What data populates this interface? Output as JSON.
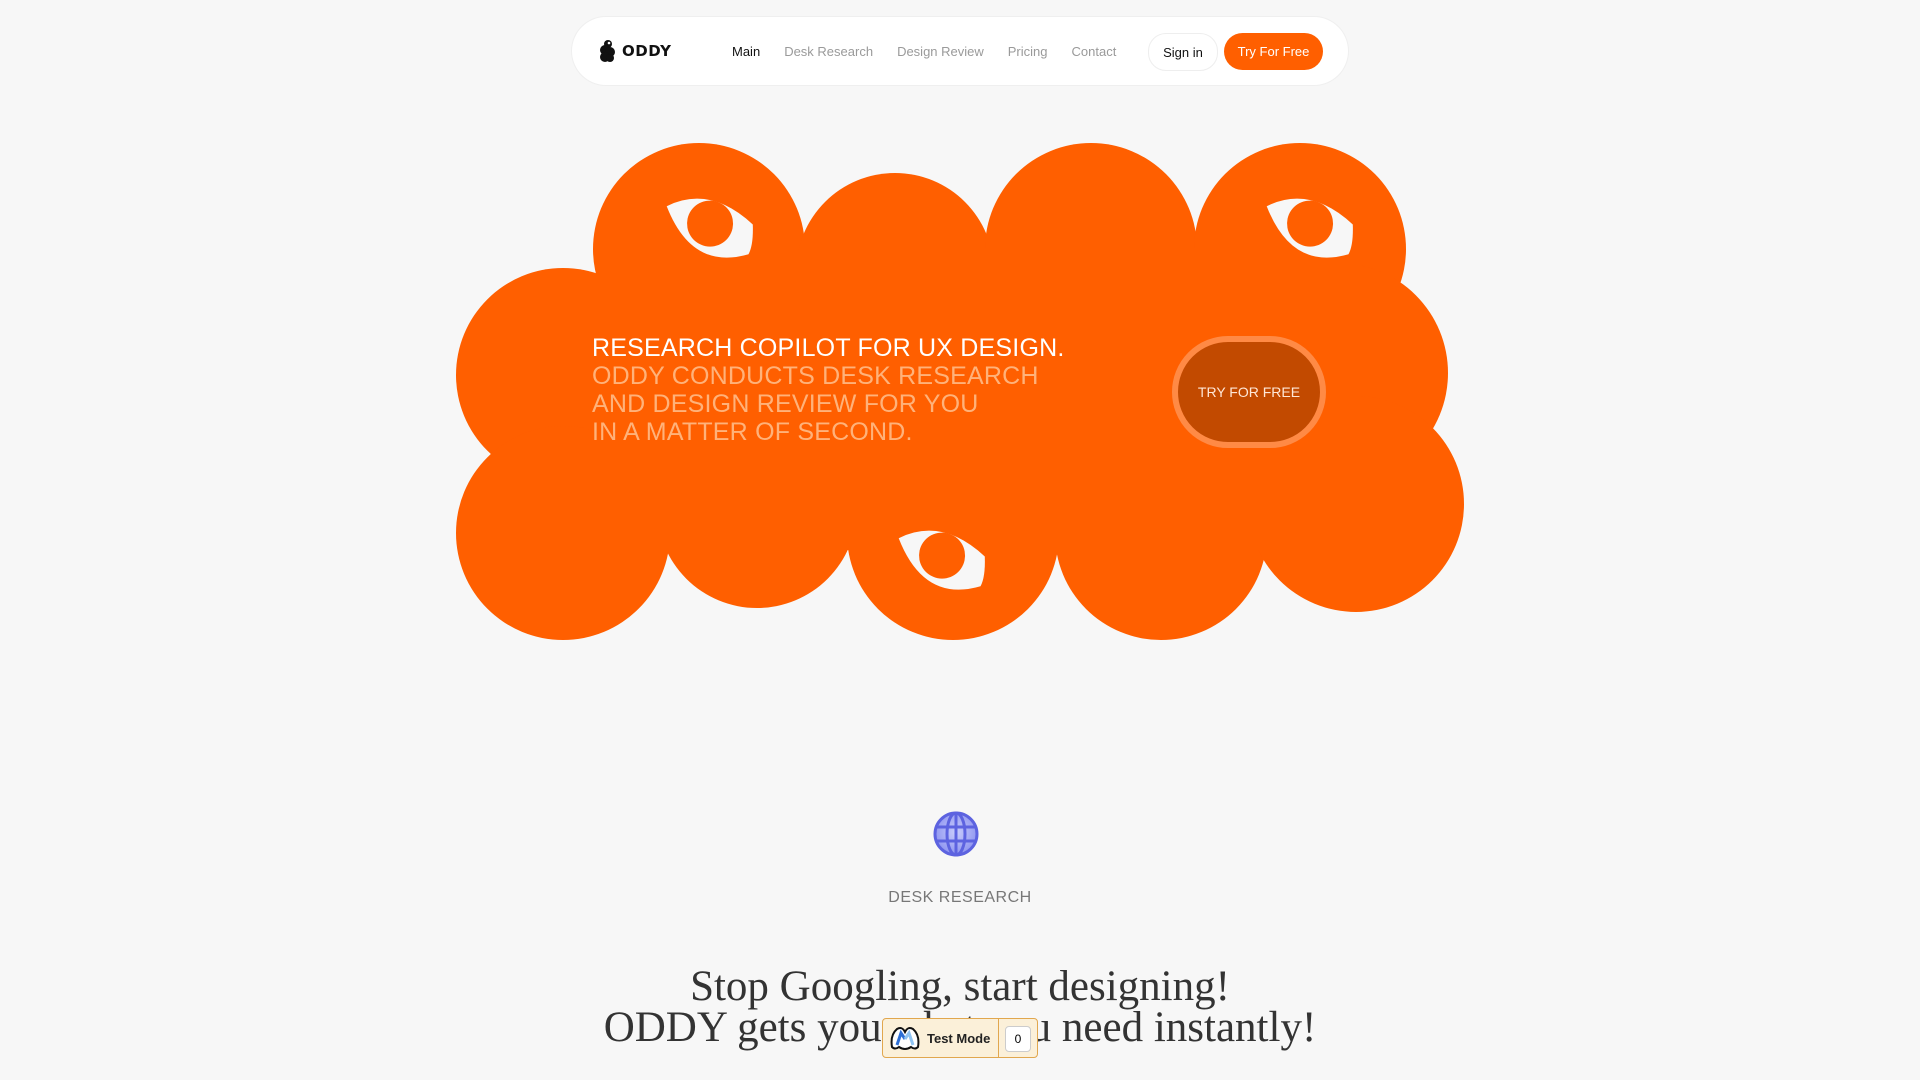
{
  "nav": {
    "brand": "ODDY",
    "links": [
      {
        "label": "Main",
        "active": true
      },
      {
        "label": "Desk Research",
        "active": false
      },
      {
        "label": "Design Review",
        "active": false
      },
      {
        "label": "Pricing",
        "active": false
      },
      {
        "label": "Contact",
        "active": false
      }
    ],
    "signin_label": "Sign in",
    "cta_label": "Try For Free"
  },
  "hero": {
    "lines": [
      "RESEARCH COPILOT FOR UX DESIGN.",
      "ODDY CONDUCTS DESK RESEARCH",
      "AND DESIGN REVIEW FOR YOU",
      "IN A MATTER OF SECOND."
    ],
    "cta_label": "TRY FOR FREE",
    "colors": {
      "brand": "#ff5f00",
      "cta_bg": "#c24a00",
      "cta_ring": "#ff8a45"
    }
  },
  "feature": {
    "icon": "globe-icon",
    "label": "DESK RESEARCH"
  },
  "section_heading": {
    "line1": "Stop Googling, start designing!",
    "line2": "ODDY gets you what you need instantly!"
  },
  "test_badge": {
    "label": "Test Mode",
    "count": "0"
  }
}
